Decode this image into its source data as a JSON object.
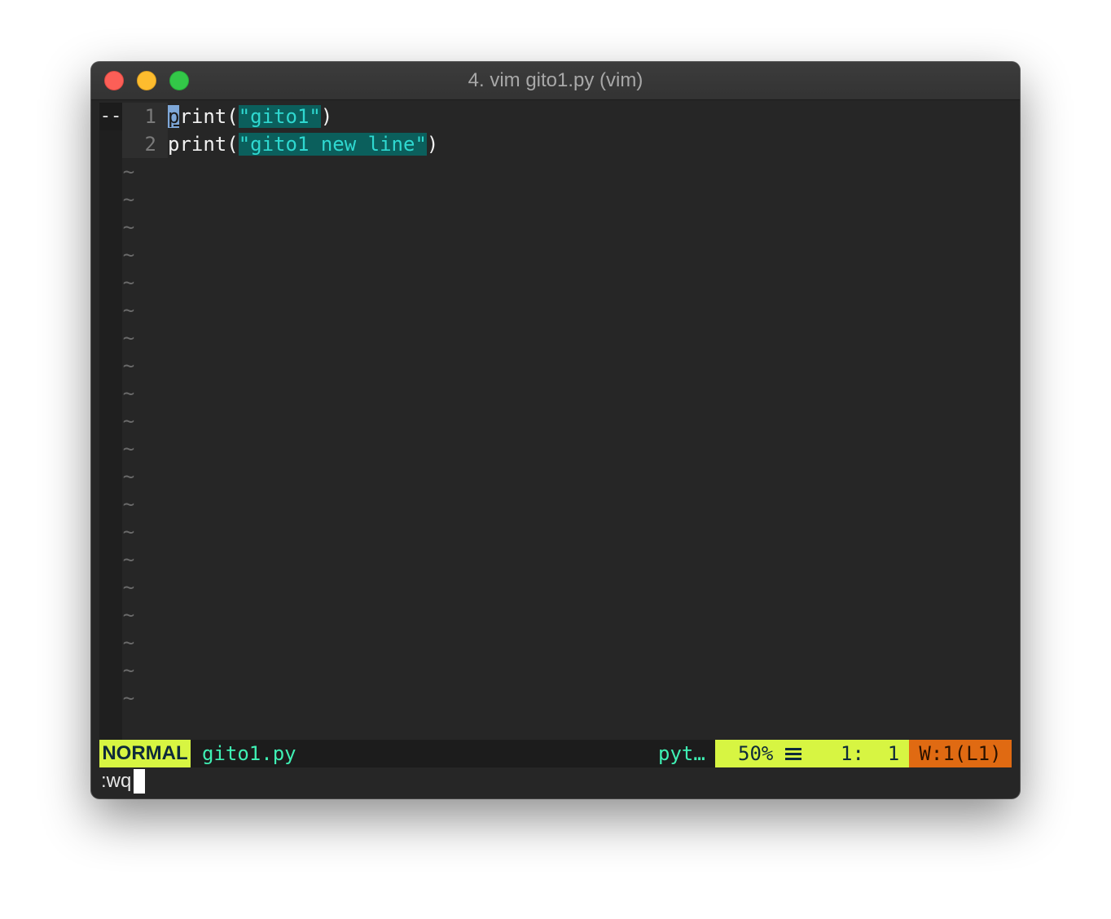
{
  "window": {
    "title": "4. vim gito1.py (vim)"
  },
  "editor": {
    "sign_marker": "--",
    "lines": [
      {
        "number": "1",
        "first_char": "p",
        "keyword_rest": "rint",
        "open_paren": "(",
        "string": "\"gito1\"",
        "close_paren": ")"
      },
      {
        "number": "2",
        "keyword": "print",
        "open_paren": "(",
        "string": "\"gito1 new line\"",
        "close_paren": ")"
      }
    ],
    "empty_line_marker": "~",
    "empty_line_count": 20
  },
  "statusline": {
    "mode": "NORMAL",
    "filename": "gito1.py",
    "filetype": "pyt…",
    "percent": "50%",
    "position": "1:  1",
    "warnings": "W:1(L1)"
  },
  "cmdline": {
    "text": ":wq"
  },
  "colors": {
    "background": "#262626",
    "mode_bg": "#d7f542",
    "warning_bg": "#e06a12",
    "string_fg": "#2fd8d0",
    "string_bg": "#0b5f5c",
    "filename_fg": "#3ff0b4"
  }
}
